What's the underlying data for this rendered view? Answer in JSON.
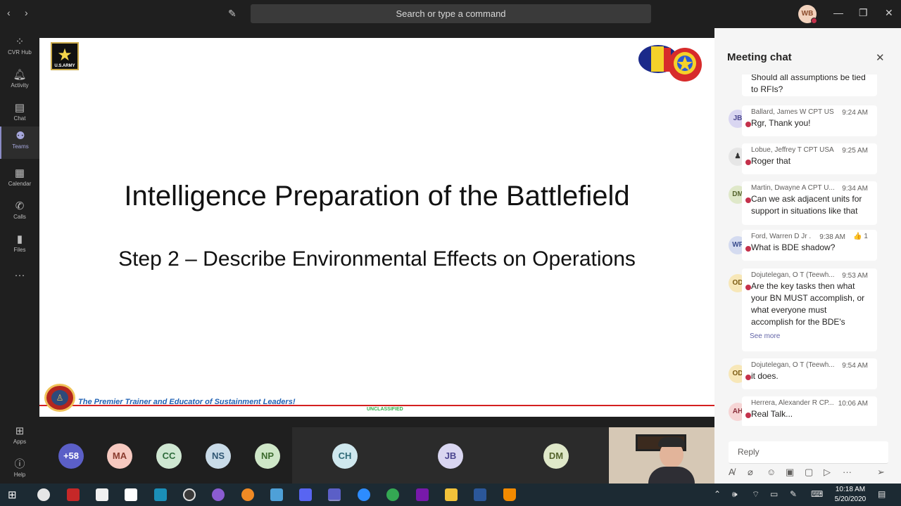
{
  "topbar": {
    "back_icon": "chevron-left-icon",
    "forward_icon": "chevron-right-icon",
    "compose_icon": "compose-icon",
    "search_placeholder": "Search or type a command",
    "me_initials": "WB"
  },
  "rail": {
    "items": [
      {
        "label": "CVR Hub",
        "icon": "cvr-hub-icon"
      },
      {
        "label": "Activity",
        "icon": "bell-icon"
      },
      {
        "label": "Chat",
        "icon": "chat-icon"
      },
      {
        "label": "Teams",
        "icon": "teams-icon"
      },
      {
        "label": "Calendar",
        "icon": "calendar-icon"
      },
      {
        "label": "Calls",
        "icon": "phone-icon"
      },
      {
        "label": "Files",
        "icon": "file-icon"
      },
      {
        "label": "Apps",
        "icon": "apps-icon"
      },
      {
        "label": "Help",
        "icon": "help-icon"
      }
    ],
    "active": "Teams"
  },
  "slide": {
    "title": "Intelligence Preparation of the Battlefield",
    "subtitle": "Step 2 – Describe Environmental Effects on Operations",
    "army_logo_text": "U.S.ARMY",
    "tagline": "The Premier Trainer and Educator of Sustainment Leaders!",
    "classification": "UNCLASSIFIED",
    "crest_text": "SUPPORT STARTS HERE"
  },
  "participants": [
    {
      "initials": "+58",
      "bg": "#5b5fc7",
      "fg": "#ffffff"
    },
    {
      "initials": "MA",
      "bg": "#f6c9c0",
      "fg": "#8a3b2e"
    },
    {
      "initials": "CC",
      "bg": "#cfe7d2",
      "fg": "#2e6b3b"
    },
    {
      "initials": "NS",
      "bg": "#c9dbe8",
      "fg": "#2f5673"
    },
    {
      "initials": "NP",
      "bg": "#cfe7c8",
      "fg": "#3c6b2e"
    },
    {
      "initials": "CH",
      "bg": "#cfe8ee",
      "fg": "#2f6b78"
    },
    {
      "initials": "JB",
      "bg": "#d9d6f1",
      "fg": "#4b4690"
    },
    {
      "initials": "DM",
      "bg": "#dfe8c9",
      "fg": "#56652e"
    }
  ],
  "chat": {
    "title": "Meeting chat",
    "messages": [
      {
        "initials": "",
        "name": "",
        "time": "",
        "text": "Should all assumptions be tied to RFIs?"
      },
      {
        "initials": "JB",
        "name": "Ballard, James W CPT US...",
        "time": "9:24 AM",
        "text": "Rgr, Thank you!",
        "av_bg": "#d9d6f1",
        "av_fg": "#4b4690"
      },
      {
        "initials": "",
        "name": "Lobue, Jeffrey T CPT USA...",
        "time": "9:25 AM",
        "text": "Roger that",
        "av_bg": "#e6e6e6",
        "av_fg": "#333333"
      },
      {
        "initials": "DM",
        "name": "Martin, Dwayne A CPT U...",
        "time": "9:34 AM",
        "text": "Can we ask adjacent units for support in situations like that",
        "av_bg": "#dfe8c9",
        "av_fg": "#56652e"
      },
      {
        "initials": "WF",
        "name": "Ford, Warren D Jr ...",
        "time": "9:38 AM",
        "reaction": "👍 1",
        "text": "What is BDE shadow?",
        "av_bg": "#d4dbf0",
        "av_fg": "#3b4e8f"
      },
      {
        "initials": "OD",
        "name": "Dojutelegan, O T (Teewh...",
        "time": "9:53 AM",
        "text": "Are the key tasks then what your BN MUST accomplish, or what everyone must accomplish for the BDE's",
        "more": "See more",
        "av_bg": "#f7e7b8",
        "av_fg": "#7a5a12"
      },
      {
        "initials": "OD",
        "name": "Dojutelegan, O T (Teewh...",
        "time": "9:54 AM",
        "text": "it does.",
        "av_bg": "#f7e7b8",
        "av_fg": "#7a5a12"
      },
      {
        "initials": "AH",
        "name": "Herrera, Alexander R CP...",
        "time": "10:06 AM",
        "text": "Real Talk...",
        "av_bg": "#f6d5d5",
        "av_fg": "#8a2e3a"
      }
    ],
    "reply_placeholder": "Reply"
  },
  "taskbar": {
    "time": "10:18 AM",
    "date": "5/20/2020"
  },
  "colors": {
    "accent": "#6264a7",
    "unread": "#c4314b"
  }
}
